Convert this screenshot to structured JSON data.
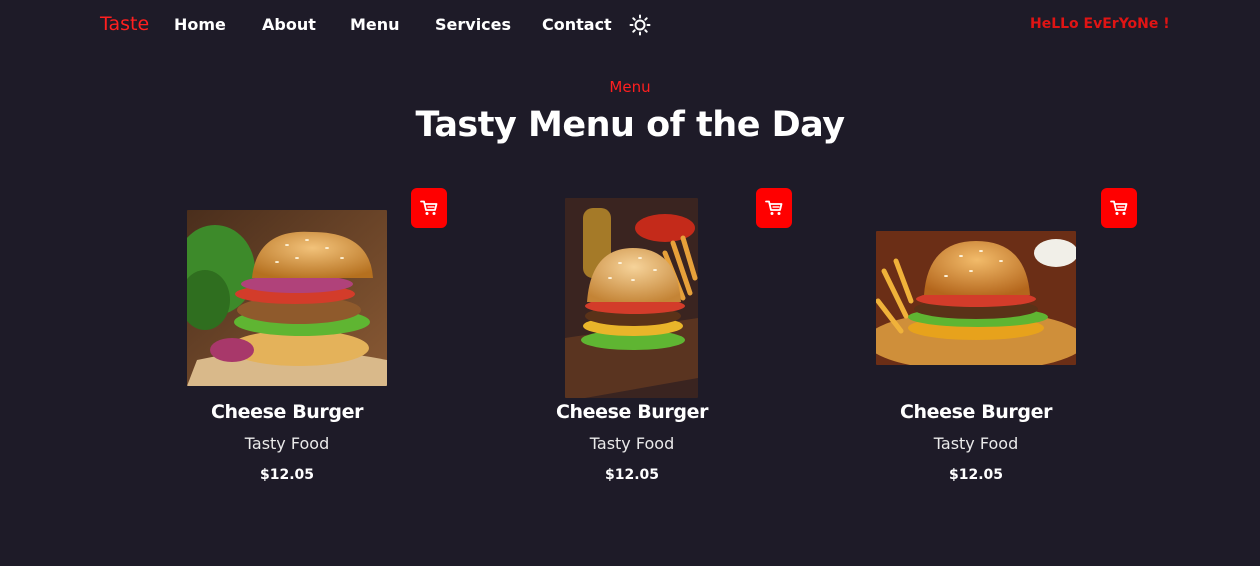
{
  "nav": {
    "logo": "Taste",
    "links": [
      "Home",
      "About",
      "Menu",
      "Services",
      "Contact"
    ],
    "theme_icon": "sun-icon",
    "greeting": "HeLLo EvErYoNe !"
  },
  "section": {
    "tag": "Menu",
    "title": "Tasty Menu of the Day"
  },
  "items": [
    {
      "name": "Cheese Burger",
      "desc": "Tasty Food",
      "price": "$12.05",
      "cart_icon": "cart-icon"
    },
    {
      "name": "Cheese Burger",
      "desc": "Tasty Food",
      "price": "$12.05",
      "cart_icon": "cart-icon"
    },
    {
      "name": "Cheese Burger",
      "desc": "Tasty Food",
      "price": "$12.05",
      "cart_icon": "cart-icon"
    }
  ],
  "colors": {
    "background": "#1e1b28",
    "accent": "#ff0000",
    "greeting": "#e01414"
  }
}
